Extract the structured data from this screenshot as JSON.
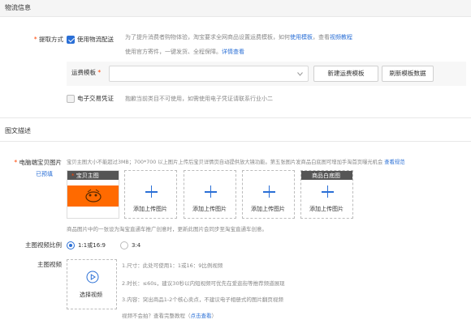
{
  "logistics": {
    "section_title": "物流信息",
    "pickup_label": "提取方式",
    "use_logistics_label": "使用物流配送",
    "notice_line1_prefix": "为了提升消费者购物体验，淘宝要求全网商品设置运费模板，如何",
    "notice_link1": "使用模板",
    "notice_mid": "，查看",
    "notice_link2": "视频教程",
    "notice_line2_prefix": "使用官方寄件，一键发货、全程保障。",
    "notice_link3": "详情查看",
    "freight_label": "运费模板",
    "freight_value": "",
    "new_template_button": "新建运费模板",
    "refresh_button": "刷新模板数据",
    "e_voucher_label": "电子交易凭证",
    "e_voucher_note": "抱歉当前类目不可使用，如需使用电子凭证请联系行业小二",
    "checked": true
  },
  "graphic": {
    "section_title": "图文描述",
    "pc_image_label": "电脑端宝贝图片",
    "pre_badge": "已预填",
    "image_hint_prefix": "宝贝主图大小不能超过3MB；700*700 以上图片上传后宝贝详情页自动提供放大镜功能。第五张图片发商品白底图可增加手淘首页曝光机会",
    "image_hint_link": "查看规范",
    "main_image_tag": "宝贝主图",
    "white_image_tag": "商品白底图",
    "upload_label": "添加上传图片",
    "promo_note": "商品图片中的一张设为淘宝直通车推广创意时，更新此图片会同步至淘宝直通车创意。",
    "ratio_label": "主图视频比例",
    "ratio_opt1": "1:1或16:9",
    "ratio_opt2": "3:4",
    "video_label": "主图视频",
    "select_video": "选择视频",
    "video_tip1": "1.尺寸：此处可使用1：1或16：9比例视频",
    "video_tip2": "2.时长：≤60s，建议30秒以内短视频可优先在爱逛街等推荐频道展现",
    "video_tip3": "3.内容：突出商品1-2个核心卖点，不建议电子相册式的图片翻页视频",
    "video_tip4_prefix": "视频不会拍？查看完整教程（",
    "video_tip4_link": "点击查看",
    "video_tip4_suffix": "）",
    "selected_ratio": "1:1或16:9"
  },
  "colors": {
    "accent": "#2a6fd6",
    "required": "#ff4400",
    "main_image_bg": "#ff6a00"
  }
}
